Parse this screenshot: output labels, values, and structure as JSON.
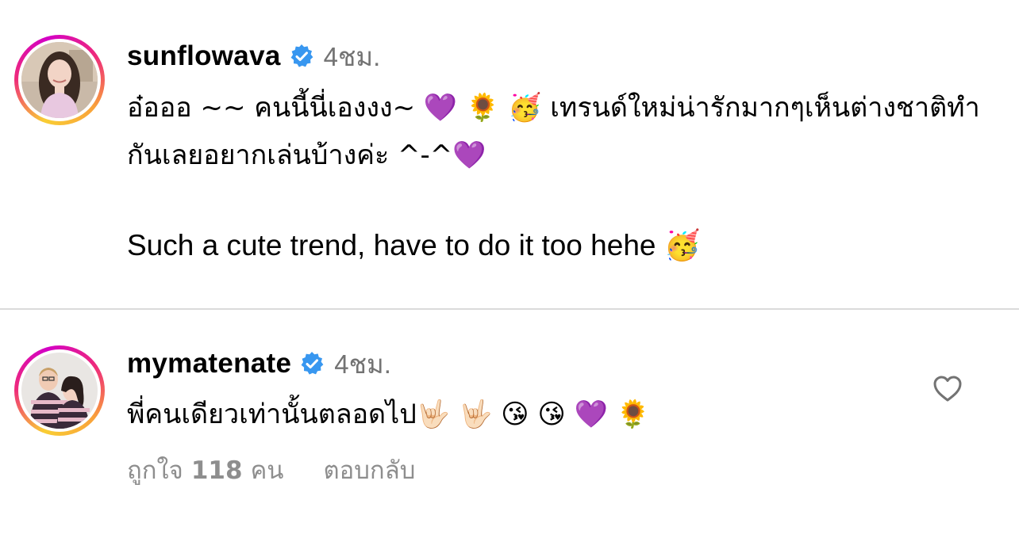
{
  "comments": [
    {
      "username": "sunflowava",
      "timestamp": "4ชม.",
      "text_thai": "อ๋อออ ~~ คนนี้นี่เองงง~ 💜 🌻 🥳 เทรนด์ใหม่น่ารักมากๆเห็นต่างชาติทำกันเลยอยากเล่นบ้างค่ะ ^-^💜",
      "text_english": "Such a cute trend, have to do it too hehe 🥳"
    },
    {
      "username": "mymatenate",
      "timestamp": "4ชม.",
      "text": "พี่คนเดียวเท่านั้นตลอดไป🤟🏻 🤟🏻 😘 😘 💜 🌻",
      "likes_prefix": "ถูกใจ",
      "likes_count": "118",
      "likes_suffix": "คน",
      "reply_label": "ตอบกลับ"
    }
  ],
  "colors": {
    "verified_badge": "#3897f0",
    "secondary_text": "#737373",
    "divider": "#dbdbdb"
  },
  "icons": {
    "verified": "verified-badge-icon",
    "like": "heart-outline-icon"
  }
}
